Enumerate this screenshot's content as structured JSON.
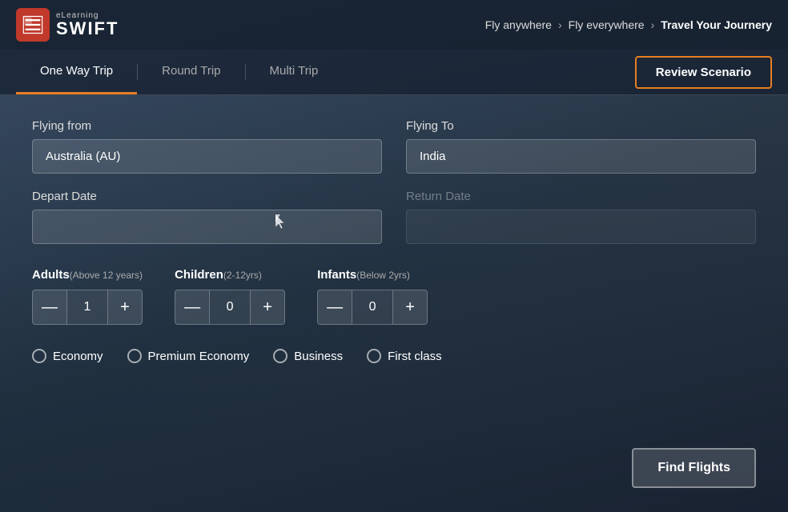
{
  "header": {
    "logo": {
      "elearning": "eLearning",
      "swift": "SWIFT"
    },
    "breadcrumb": {
      "item1": "Fly anywhere",
      "item2": "Fly everywhere",
      "item3": "Travel Your Journery"
    }
  },
  "tabs": {
    "tab1": "One Way Trip",
    "tab2": "Round Trip",
    "tab3": "Multi Trip",
    "review_btn": "Review Scenario",
    "active_tab": "tab1"
  },
  "form": {
    "flying_from_label": "Flying from",
    "flying_from_value": "Australia (AU)",
    "flying_from_placeholder": "Australia (AU)",
    "flying_to_label": "Flying To",
    "flying_to_value": "India",
    "flying_to_placeholder": "India",
    "depart_date_label": "Depart Date",
    "depart_date_value": "",
    "depart_date_placeholder": "",
    "return_date_label": "Return Date",
    "return_date_value": "",
    "return_date_placeholder": ""
  },
  "passengers": {
    "adults": {
      "label": "Adults",
      "sublabel": "(Above 12 years)",
      "value": "1"
    },
    "children": {
      "label": "Children",
      "sublabel": "(2-12yrs)",
      "value": "0"
    },
    "infants": {
      "label": "Infants",
      "sublabel": "(Below 2yrs)",
      "value": "0"
    }
  },
  "cabin_classes": {
    "economy": "Economy",
    "premium_economy": "Premium Economy",
    "business": "Business",
    "first_class": "First class"
  },
  "actions": {
    "find_flights": "Find Flights"
  },
  "stepper": {
    "decrement": "—",
    "increment": "+"
  }
}
